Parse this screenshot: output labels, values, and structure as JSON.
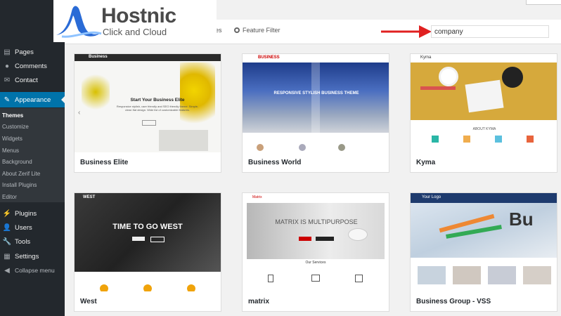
{
  "logo": {
    "name": "Hostnic",
    "tagline": "Click and Cloud"
  },
  "sidebar": {
    "items": [
      {
        "label": "Pages",
        "icon": "pages-icon"
      },
      {
        "label": "Comments",
        "icon": "comments-icon"
      },
      {
        "label": "Contact",
        "icon": "mail-icon"
      },
      {
        "label": "Appearance",
        "icon": "brush-icon"
      },
      {
        "label": "Plugins",
        "icon": "plug-icon"
      },
      {
        "label": "Users",
        "icon": "user-icon"
      },
      {
        "label": "Tools",
        "icon": "wrench-icon"
      },
      {
        "label": "Settings",
        "icon": "settings-icon"
      },
      {
        "label": "Collapse menu",
        "icon": "collapse-icon"
      }
    ],
    "submenu": [
      "Themes",
      "Customize",
      "Widgets",
      "Menus",
      "Background",
      "About Zerif Lite",
      "Install Plugins",
      "Editor"
    ]
  },
  "filters": {
    "favorites": "vorites",
    "feature_filter": "Feature Filter"
  },
  "search": {
    "value": "company"
  },
  "themes": [
    {
      "name": "Business Elite",
      "brand": "Business",
      "hero_title": "Start Your Business Elite",
      "hero_text": "Responsive stylish, user friendly and SEO friendly theme. Simple, clean flat design. Wide list of customizable features."
    },
    {
      "name": "Business World",
      "brand": "BUSINESS",
      "hero_title": "RESPONSIVE STYLISH BUSINESS THEME"
    },
    {
      "name": "Kyma",
      "brand": "Kyma",
      "hero_title": "ABOUT KYMA"
    },
    {
      "name": "West",
      "brand": "WEST",
      "hero_title": "TIME TO GO WEST"
    },
    {
      "name": "matrix",
      "brand": "Matrix",
      "hero_title": "MATRIX IS MULTIPURPOSE",
      "section": "Our Services"
    },
    {
      "name": "Business Group - VSS",
      "brand": "Your Logo"
    }
  ],
  "colors": {
    "sidebar": "#23282d",
    "active": "#0073aa",
    "arrow": "#e02020",
    "logo_blue": "#2a6bd6"
  }
}
